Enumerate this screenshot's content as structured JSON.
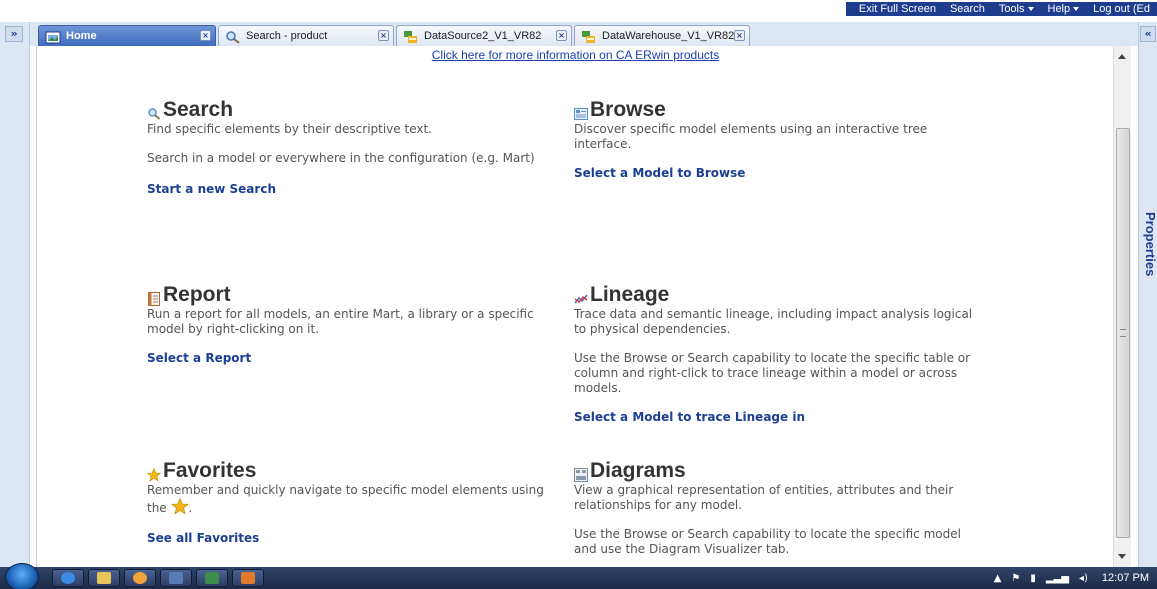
{
  "topmenu": {
    "exit_full_screen": "Exit Full Screen",
    "search": "Search",
    "tools": "Tools",
    "help": "Help",
    "logout": "Log out (Ed"
  },
  "tabs": [
    {
      "label": "Home",
      "icon": "home-icon",
      "active": true
    },
    {
      "label": "Search - product",
      "icon": "search-icon",
      "active": false
    },
    {
      "label": "DataSource2_V1_VR82",
      "icon": "model-icon",
      "active": false
    },
    {
      "label": "DataWarehouse_V1_VR82",
      "icon": "model-icon",
      "active": false
    }
  ],
  "info_link": "Click here for more information on CA ERwin products",
  "sections": {
    "search": {
      "title": "Search",
      "desc1": "Find specific elements by their descriptive text.",
      "desc2": "Search in a model or everywhere in the configuration (e.g. Mart)",
      "link": "Start a new Search"
    },
    "browse": {
      "title": "Browse",
      "desc1": "Discover specific model elements using an interactive tree interface.",
      "link": "Select a Model to Browse"
    },
    "report": {
      "title": "Report",
      "desc1": "Run a report for all models, an entire Mart, a library or a specific model by right-clicking on it.",
      "link": "Select a Report"
    },
    "lineage": {
      "title": "Lineage",
      "desc1": "Trace data and semantic lineage, including impact analysis logical to physical dependencies.",
      "desc2": "Use the Browse or Search capability to locate the specific table or column and right-click to trace lineage within a model or across models.",
      "link": "Select a Model to trace Lineage in"
    },
    "favorites": {
      "title": "Favorites",
      "desc1": "Remember and quickly navigate to specific model elements using the",
      "desc1_end": ".",
      "link": "See all Favorites"
    },
    "diagrams": {
      "title": "Diagrams",
      "desc1": "View a graphical representation of entities, attributes and their relationships for any model.",
      "desc2": "Use the Browse or Search capability to locate the specific model and use the Diagram Visualizer tab."
    }
  },
  "side": {
    "properties_label": "Properties",
    "left_expand": "»",
    "right_expand": "«"
  },
  "taskbar": {
    "clock": "12:07 PM"
  },
  "colors": {
    "accent": "#1f3d8f",
    "link": "#1c3f94",
    "tab_active": "#3f6bbf",
    "taskbar": "#1b2a47"
  }
}
